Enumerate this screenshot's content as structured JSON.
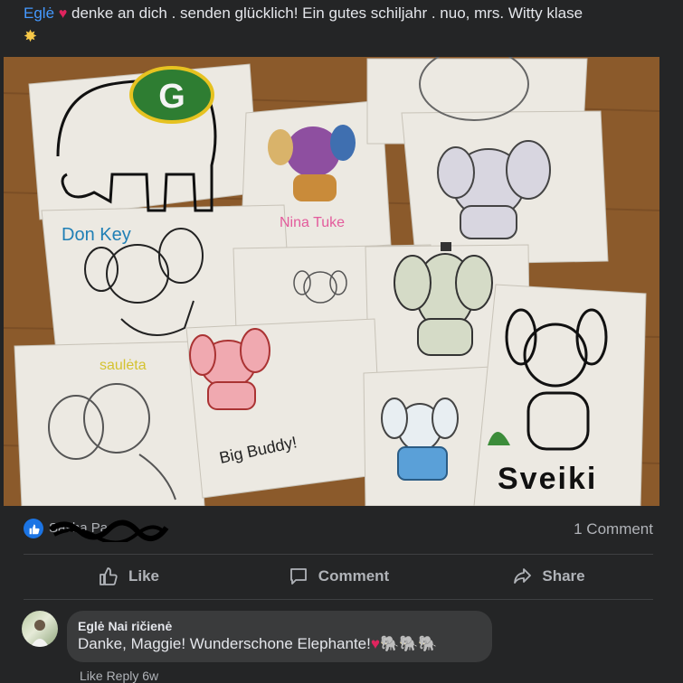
{
  "post": {
    "author": "Eglė",
    "caption_text": " denke an dich . senden glücklich! Ein gutes schiljahr .  nuo, mrs. Witty klase",
    "heart_glyph": "♥",
    "sparkle_glyph": "✸"
  },
  "photo": {
    "labels": {
      "don_key": "Don Key",
      "nina": "Nina Tuke",
      "saulete": "saulėta",
      "big_buddy": "Big Buddy!",
      "sveiki": "Sveiki"
    },
    "colors": {
      "table": "#8b5a2b",
      "paper": "#ece9e2"
    }
  },
  "reactions": {
    "reactor_text": "Sasha Pa",
    "comment_count": "1 Comment"
  },
  "actions": [
    {
      "label": "Like",
      "icon": "thumbs-up-icon"
    },
    {
      "label": "Comment",
      "icon": "speech-bubble-icon"
    },
    {
      "label": "Share",
      "icon": "share-arrow-icon"
    }
  ],
  "comment": {
    "author": "Eglė Nai     ričienė",
    "text": "Danke, Maggie! Wunderschone Elephante!",
    "heart": "♥",
    "elephants": "🐘🐘🐘"
  },
  "cutoff_text": "Like  Reply  6w"
}
